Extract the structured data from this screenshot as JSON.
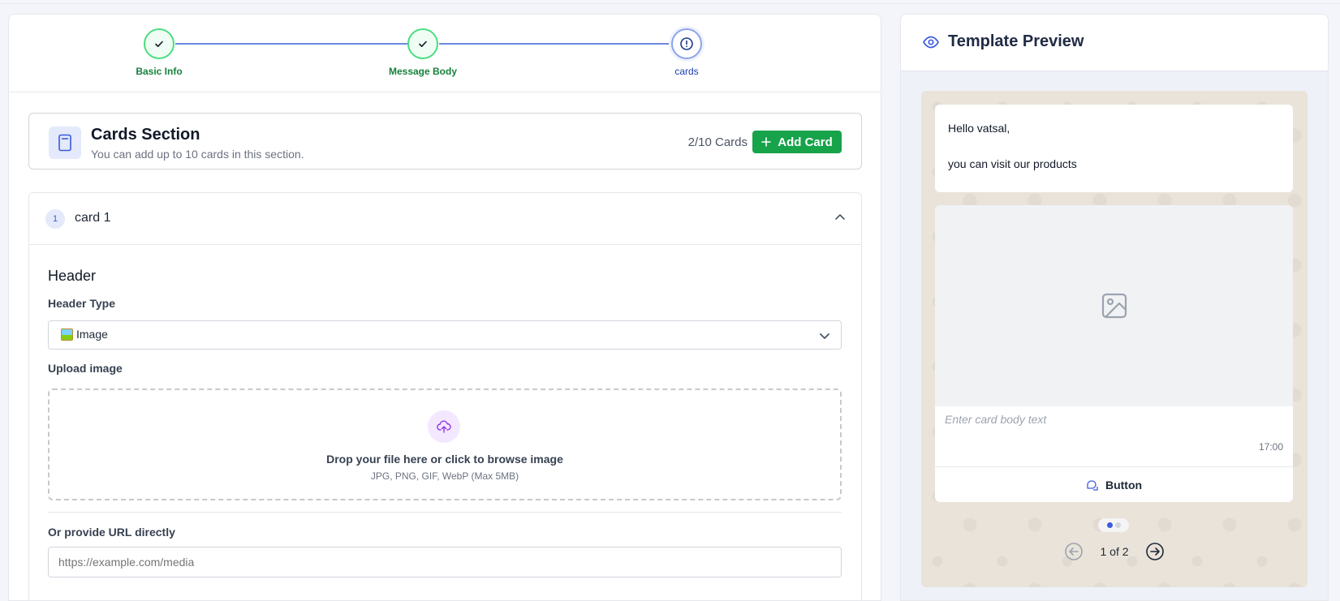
{
  "stepper": {
    "steps": [
      {
        "label": "Basic Info",
        "status": "complete"
      },
      {
        "label": "Message Body",
        "status": "complete"
      },
      {
        "label": "cards",
        "status": "active"
      }
    ]
  },
  "cards_section": {
    "title": "Cards Section",
    "subtitle": "You can add up to 10 cards in this section.",
    "count": "2/10 Cards",
    "add_button": "Add Card"
  },
  "card": {
    "number": "1",
    "title": "card 1",
    "header_heading": "Header",
    "header_type_label": "Header Type",
    "header_type_value": "Image",
    "upload_label": "Upload image",
    "dropzone_title": "Drop your file here or click to browse image",
    "dropzone_sub": "JPG, PNG, GIF, WebP (Max 5MB)",
    "url_label": "Or provide URL directly",
    "url_placeholder": "https://example.com/media"
  },
  "preview": {
    "title": "Template Preview",
    "message_line1": "Hello vatsal,",
    "message_line2": "you can visit our products",
    "card_body_placeholder": "Enter card body text",
    "time": "17:00",
    "button_label": "Button",
    "pager_text": "1 of 2"
  },
  "colors": {
    "accent_green": "#16a34a",
    "step_active": "#1e40af",
    "chat_bg": "#e9e3d9"
  }
}
